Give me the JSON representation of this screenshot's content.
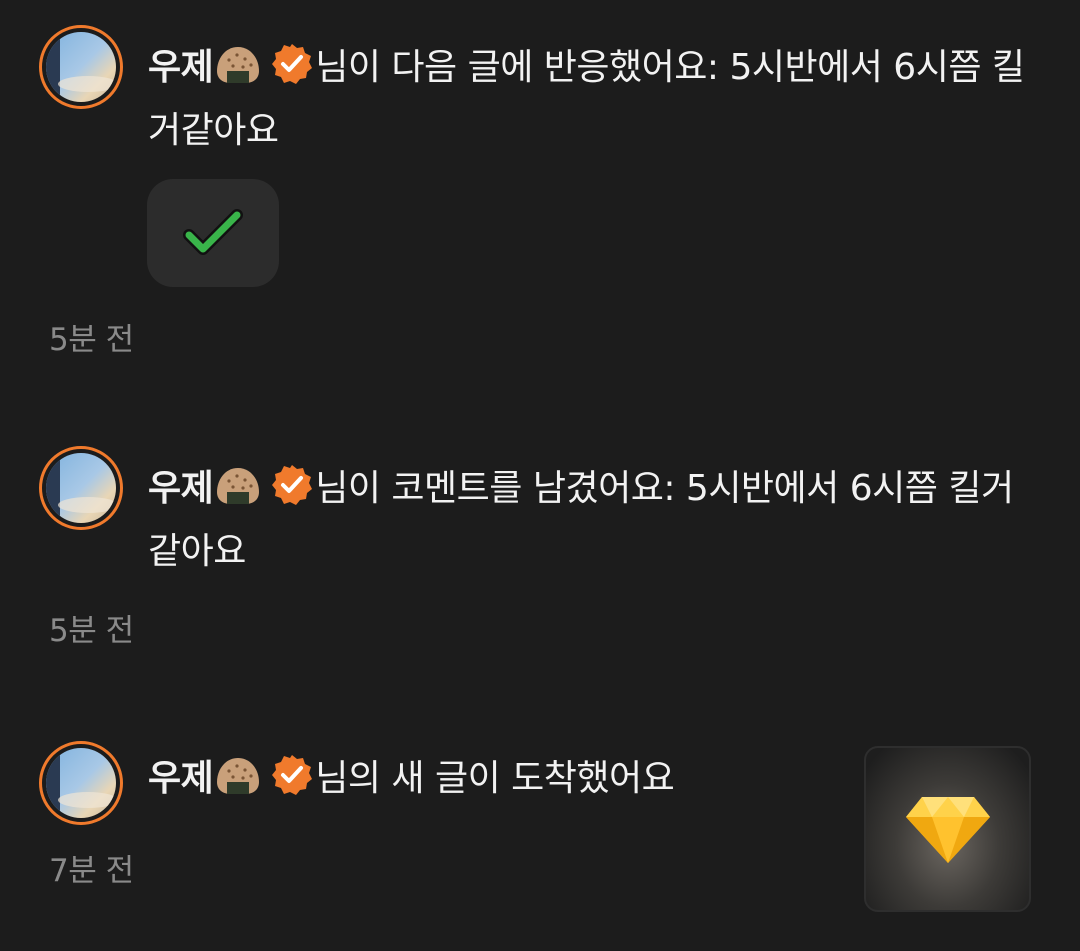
{
  "notifications": [
    {
      "username": "우제",
      "message": "님이 다음 글에 반응했어요: 5시반에서 6시쯤 킬거같아요",
      "time": "5분 전",
      "reaction": "✔️"
    },
    {
      "username": "우제",
      "message": "님이 코멘트를 남겼어요: 5시반에서 6시쯤 킬거같아요",
      "time": "5분 전"
    },
    {
      "username": "우제",
      "message": "님의 새 글이 도착했어요",
      "time": "7분 전",
      "thumbnail_icon": "gem-icon"
    }
  ],
  "colors": {
    "background": "#1c1c1c",
    "accent": "#f07a2c",
    "verified_badge": "#f07a2c",
    "time_text": "#8a8a8a",
    "reaction_check": "#39b54a",
    "gem": "#f6b81c"
  },
  "icons": {
    "avatar": "sky-photo-avatar",
    "username_emoji": "rice-ball-icon",
    "verified": "verified-badge-icon"
  }
}
